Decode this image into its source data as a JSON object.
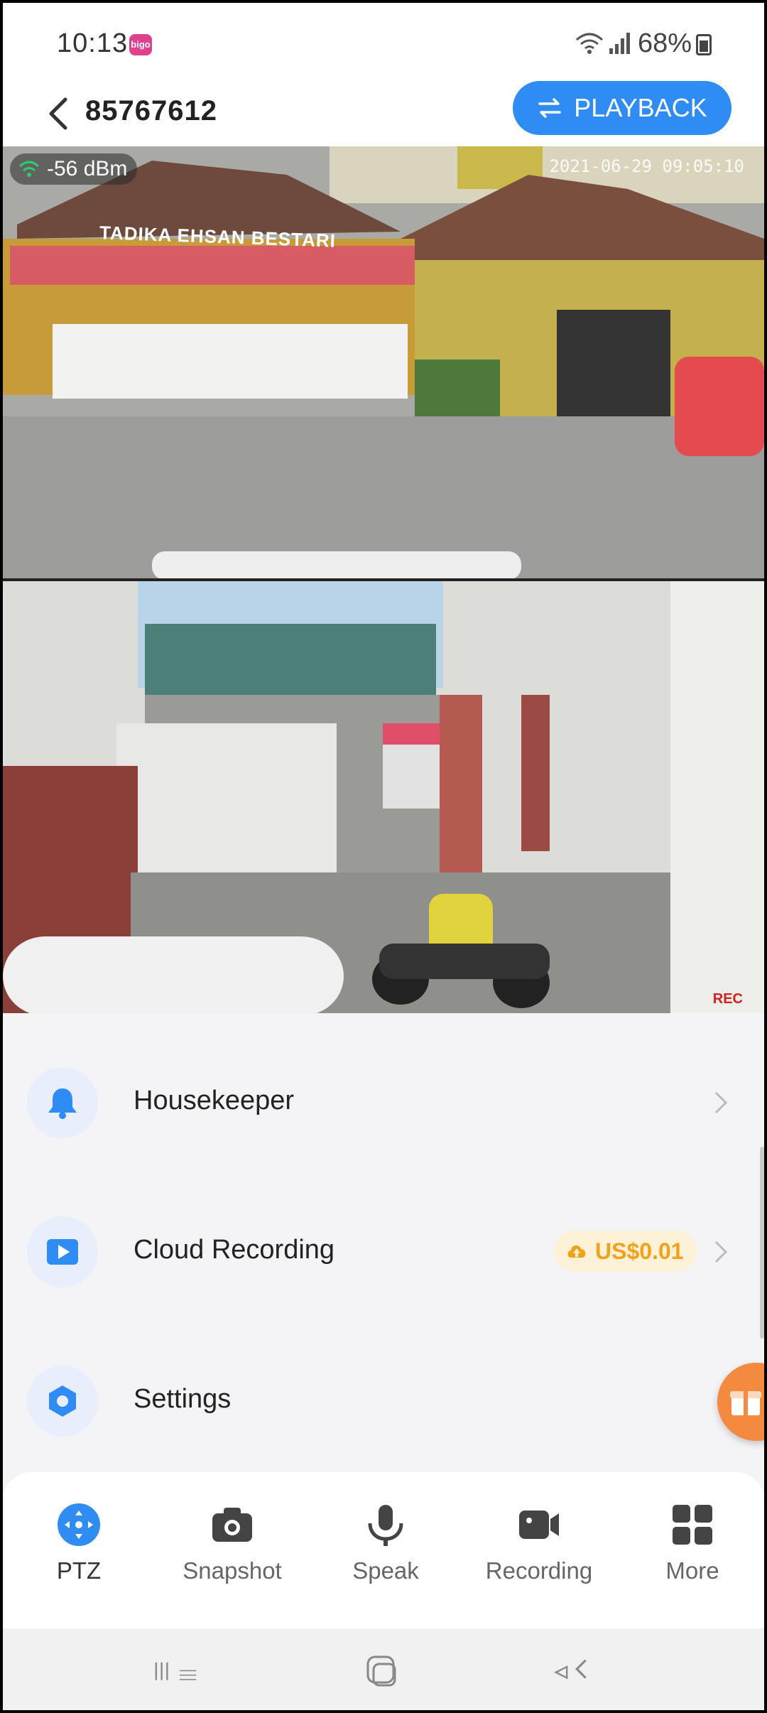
{
  "status_bar": {
    "time": "10:13",
    "notification_badge": "bigo",
    "battery": "68%",
    "icons": [
      "wifi-icon",
      "signal-icon",
      "battery-icon"
    ]
  },
  "header": {
    "title": "85767612",
    "playback_label": "PLAYBACK"
  },
  "feeds": {
    "signal": "-56 dBm",
    "timestamp": "2021-06-29  09:05:10",
    "sign": "TADIKA EHSAN BESTARI",
    "rec": "REC"
  },
  "menu": {
    "items": [
      {
        "label": "Housekeeper",
        "icon": "bell-icon"
      },
      {
        "label": "Cloud Recording",
        "icon": "play-icon",
        "price": "US$0.01"
      },
      {
        "label": "Settings",
        "icon": "gear-icon"
      }
    ]
  },
  "toolbar": {
    "items": [
      {
        "label": "PTZ",
        "icon": "ptz-icon"
      },
      {
        "label": "Snapshot",
        "icon": "camera-icon"
      },
      {
        "label": "Speak",
        "icon": "microphone-icon"
      },
      {
        "label": "Recording",
        "icon": "video-icon"
      },
      {
        "label": "More",
        "icon": "grid-icon"
      }
    ]
  },
  "colors": {
    "accent": "#2f8cf3",
    "price": "#f0a21a",
    "gift": "#f48a3f",
    "background": "#f4f4f6"
  }
}
